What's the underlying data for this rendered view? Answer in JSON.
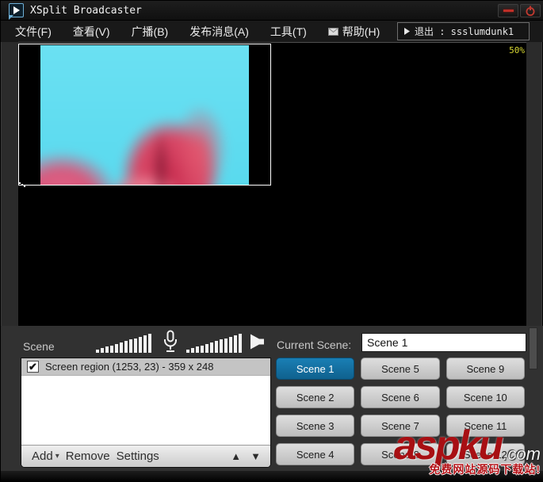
{
  "titlebar": {
    "title": "XSplit Broadcaster"
  },
  "menu": {
    "items": [
      "文件(F)",
      "查看(V)",
      "广播(B)",
      "发布消息(A)",
      "工具(T)",
      "帮助(H)"
    ],
    "exit_label": "退出 : ssslumdunk1"
  },
  "preview": {
    "zoom_level": "50%"
  },
  "audio": {
    "meter_bar_count": 12
  },
  "scene_panel": {
    "label": "Scene",
    "source": {
      "checked": true,
      "check_glyph": "✔",
      "label": "Screen region (1253, 23) - 359 x 248"
    },
    "toolbar": {
      "add": "Add",
      "add_caret": "▾",
      "remove": "Remove",
      "settings": "Settings",
      "up_glyph": "▲",
      "down_glyph": "▼"
    }
  },
  "current_scene": {
    "label": "Current Scene:",
    "value": "Scene 1"
  },
  "scenes": {
    "active": "Scene 1",
    "buttons": [
      "Scene 1",
      "Scene 2",
      "Scene 3",
      "Scene 4",
      "Scene 5",
      "Scene 6",
      "Scene 7",
      "Scene 8",
      "Scene 9",
      "Scene 10",
      "Scene 11",
      "Scene 12"
    ]
  },
  "watermark": {
    "brand": "aspku",
    "suffix": ".com",
    "tagline": "免费网站源码下载站!"
  },
  "colors": {
    "active_scene_blue": "#146e9e",
    "accent_red": "#bf2f27",
    "zoom_label_yellow": "#d8d833",
    "watermark_red": "#b31116"
  }
}
